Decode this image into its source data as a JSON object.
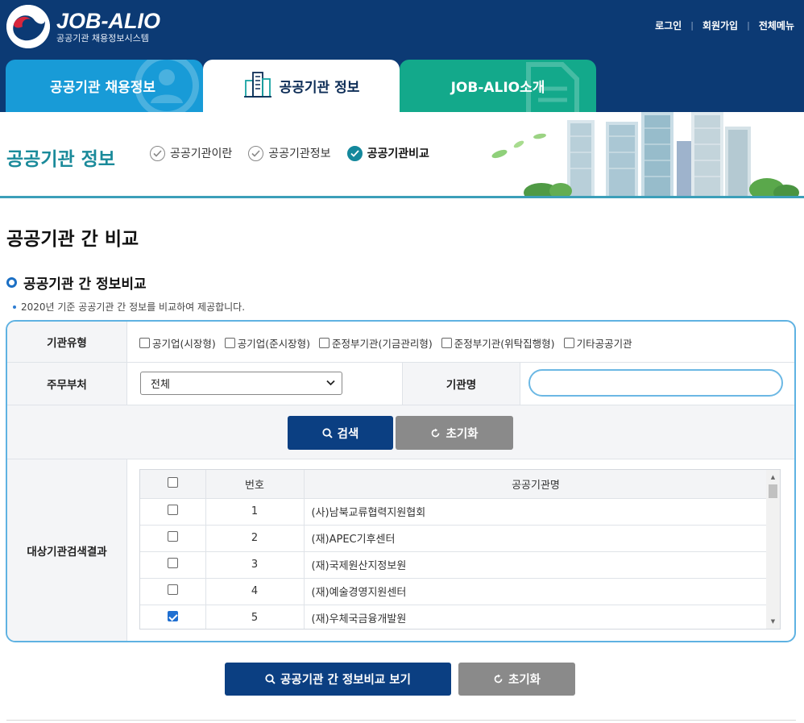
{
  "header": {
    "logo_title": "JOB-ALIO",
    "logo_sub": "공공기관 채용정보시스템",
    "util_links": [
      "로그인",
      "회원가입",
      "전체메뉴"
    ]
  },
  "tabs": [
    {
      "label": "공공기관 채용정보"
    },
    {
      "label": "공공기관 정보"
    },
    {
      "label": "JOB-ALIO소개"
    }
  ],
  "subnav": {
    "title": "공공기관 정보",
    "items": [
      {
        "label": "공공기관이란"
      },
      {
        "label": "공공기관정보"
      },
      {
        "label": "공공기관비교"
      }
    ]
  },
  "page": {
    "title": "공공기관 간 비교",
    "section_title": "공공기관 간 정보비교",
    "description": "2020년 기준 공공기관 간 정보를 비교하여 제공합니다."
  },
  "form": {
    "type_label": "기관유형",
    "types": [
      "공기업(시장형)",
      "공기업(준시장형)",
      "준정부기관(기금관리형)",
      "준정부기관(위탁집행형)",
      "기타공공기관"
    ],
    "ministry_label": "주무부처",
    "ministry_selected": "전체",
    "name_label": "기관명",
    "name_value": "",
    "search_button": "검색",
    "reset_button": "초기화"
  },
  "results": {
    "label": "대상기관검색결과",
    "columns": [
      "",
      "번호",
      "공공기관명"
    ],
    "rows": [
      {
        "no": "1",
        "name": "(사)남북교류협력지원협회",
        "checked": false
      },
      {
        "no": "2",
        "name": "(재)APEC기후센터",
        "checked": false
      },
      {
        "no": "3",
        "name": "(재)국제원산지정보원",
        "checked": false
      },
      {
        "no": "4",
        "name": "(재)예술경영지원센터",
        "checked": false
      },
      {
        "no": "5",
        "name": "(재)우체국금융개발원",
        "checked": true
      }
    ]
  },
  "actions": {
    "compare_button": "공공기관 간 정보비교 보기",
    "reset_button": "초기화"
  },
  "colors": {
    "header_bg": "#0c3a74",
    "tab_recruit": "#189bd7",
    "tab_about": "#13a98b",
    "accent_teal": "#1a8a9a",
    "primary_button": "#0b3f82",
    "secondary_button": "#8a8a8a"
  }
}
